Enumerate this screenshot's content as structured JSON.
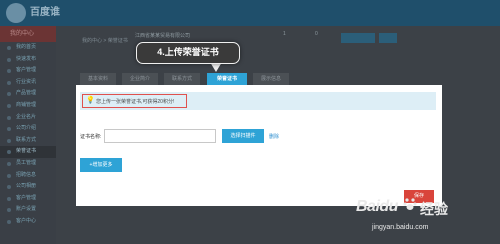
{
  "header": {
    "brand": "百度谁",
    "tagline": ""
  },
  "sidebar": {
    "title": "我的中心",
    "items": [
      {
        "label": "我的首页"
      },
      {
        "label": "快速发布"
      },
      {
        "label": "客户管理"
      },
      {
        "label": "行业资讯"
      },
      {
        "label": "产品管理"
      },
      {
        "label": "商铺管理"
      },
      {
        "label": "企业名片"
      },
      {
        "label": "公司介绍"
      },
      {
        "label": "联系方式"
      },
      {
        "label": "员工管理"
      },
      {
        "label": "荣誉证书"
      },
      {
        "label": "招聘信息"
      },
      {
        "label": "公司相册"
      },
      {
        "label": "客户管理"
      },
      {
        "label": "账户设置"
      },
      {
        "label": "客户中心"
      }
    ]
  },
  "breadcrumb": "我的中心 > 荣誉证书",
  "user": {
    "company": "江西省某某贸易有限公司"
  },
  "stats": [
    {
      "value": "1"
    },
    {
      "value": "0"
    }
  ],
  "tabs": [
    {
      "label": "基本资料"
    },
    {
      "label": "企业简介"
    },
    {
      "label": "联系方式"
    },
    {
      "label": "荣誉证书"
    },
    {
      "label": "展示信息"
    }
  ],
  "callout": {
    "text": "4.上传荣誉证书"
  },
  "notice": {
    "text": "您上传一张荣誉证书,可获得20积分!"
  },
  "form": {
    "cert_label": "证书名称:",
    "cert_value": "",
    "pick_button": "选择扫描件",
    "delete_link": "删除",
    "add_more": "+增加更多"
  },
  "footer": {
    "save_button": "保存"
  },
  "watermark": {
    "brand": "Baidu",
    "suffix": "经验",
    "url": "jingyan.baidu.com"
  }
}
